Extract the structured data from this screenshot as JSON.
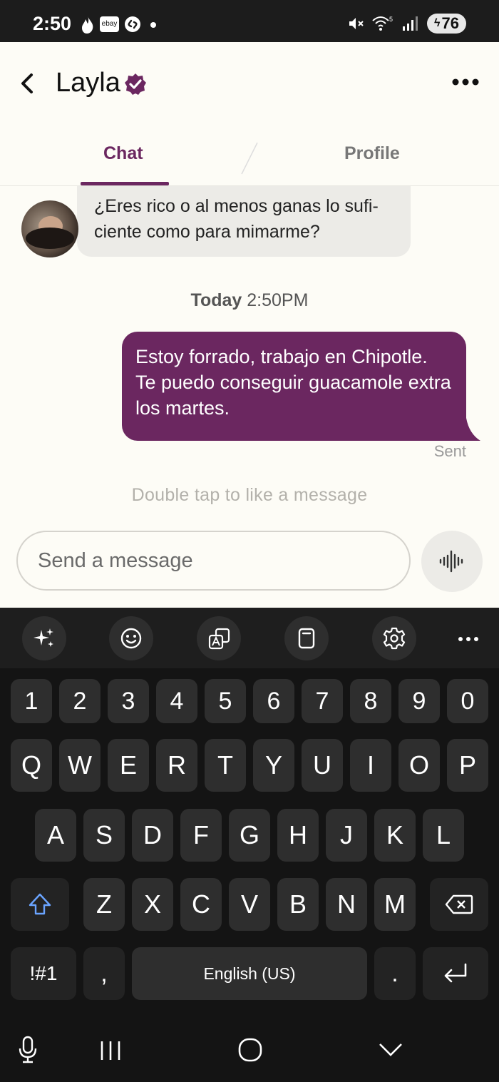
{
  "status_bar": {
    "time": "2:50",
    "app_icons": [
      "tinder-icon",
      "ebay-icon",
      "shazam-icon",
      "dot-icon"
    ],
    "ebay_label": "ebay",
    "battery": "76",
    "indicators": [
      "mute-icon",
      "wifi-icon",
      "signal-icon"
    ]
  },
  "header": {
    "name": "Layla",
    "verified": true
  },
  "tabs": [
    {
      "label": "Chat",
      "active": true
    },
    {
      "label": "Profile",
      "active": false
    }
  ],
  "messages": {
    "incoming": {
      "line1": "¿Eres rico o al menos ganas lo sufi-",
      "line2": "ciente como para mimarme?"
    },
    "timestamp_day": "Today",
    "timestamp_time": "2:50PM",
    "outgoing": {
      "line1": "Estoy forrado, trabajo en Chipotle.",
      "line2": "Te puedo conseguir guacamole extra",
      "line3": "los martes."
    },
    "sent_label": "Sent",
    "hint": "Double tap to like a message"
  },
  "composer": {
    "placeholder": "Send a message"
  },
  "keyboard": {
    "toolbar": [
      "sparkle-icon",
      "emoji-icon",
      "translate-icon",
      "clipboard-icon",
      "settings-icon",
      "more-icon"
    ],
    "row_numbers": [
      "1",
      "2",
      "3",
      "4",
      "5",
      "6",
      "7",
      "8",
      "9",
      "0"
    ],
    "row1": [
      "Q",
      "W",
      "E",
      "R",
      "T",
      "Y",
      "U",
      "I",
      "O",
      "P"
    ],
    "row2": [
      "A",
      "S",
      "D",
      "F",
      "G",
      "H",
      "J",
      "K",
      "L"
    ],
    "row3": [
      "Z",
      "X",
      "C",
      "V",
      "B",
      "N",
      "M"
    ],
    "symbols_key": "!#1",
    "comma_key": ",",
    "space_key": "English (US)",
    "period_key": "."
  },
  "colors": {
    "accent": "#6b2760",
    "background": "#fdfcf6",
    "incoming_bubble": "#ecebe7"
  }
}
